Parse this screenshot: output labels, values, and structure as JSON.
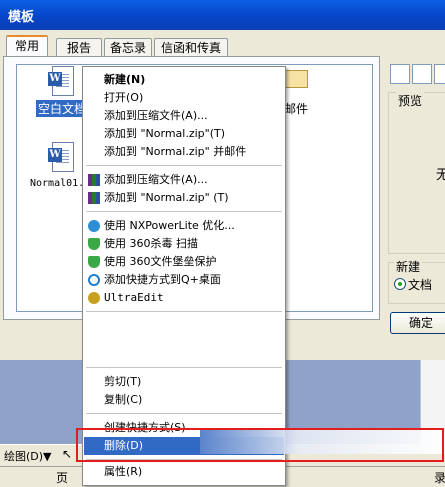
{
  "dialog": {
    "title": "模板",
    "tabs": [
      "常用",
      "报告",
      "备忘录",
      "信函和传真"
    ],
    "files": {
      "blank_doc": "空白文档",
      "email_partial": "邮件",
      "normal01": "Normal01."
    },
    "preview_label": "预览",
    "preview_text_partial": "无",
    "new_label": "新建",
    "new_option_doc": "文档",
    "ok_button": "确定"
  },
  "context_menu": {
    "groups": [
      [
        "新建(N)",
        "打开(O)",
        "添加到压缩文件(A)...",
        "添加到 \"Normal.zip\"(T)",
        "添加到 \"Normal.zip\" 并邮件"
      ],
      [
        "添加到压缩文件(A)...",
        "添加到 \"Normal.zip\" (T)"
      ],
      [
        "使用 NXPowerLite 优化...",
        "使用 360杀毒 扫描",
        "使用 360文件堡垒保护",
        "添加快捷方式到Q+桌面",
        "UltraEdit"
      ],
      [
        "剪切(T)",
        "复制(C)"
      ],
      [
        "创建快捷方式(S)",
        "删除(D)",
        "属性(R)"
      ]
    ]
  },
  "background": {
    "draw_menu": "绘图(D)▼",
    "status_page": "页",
    "status_partial": "录"
  },
  "colors": {
    "titlebar": "#0a52d8",
    "selection": "#316ac5",
    "highlight_box": "#e31c1c"
  }
}
